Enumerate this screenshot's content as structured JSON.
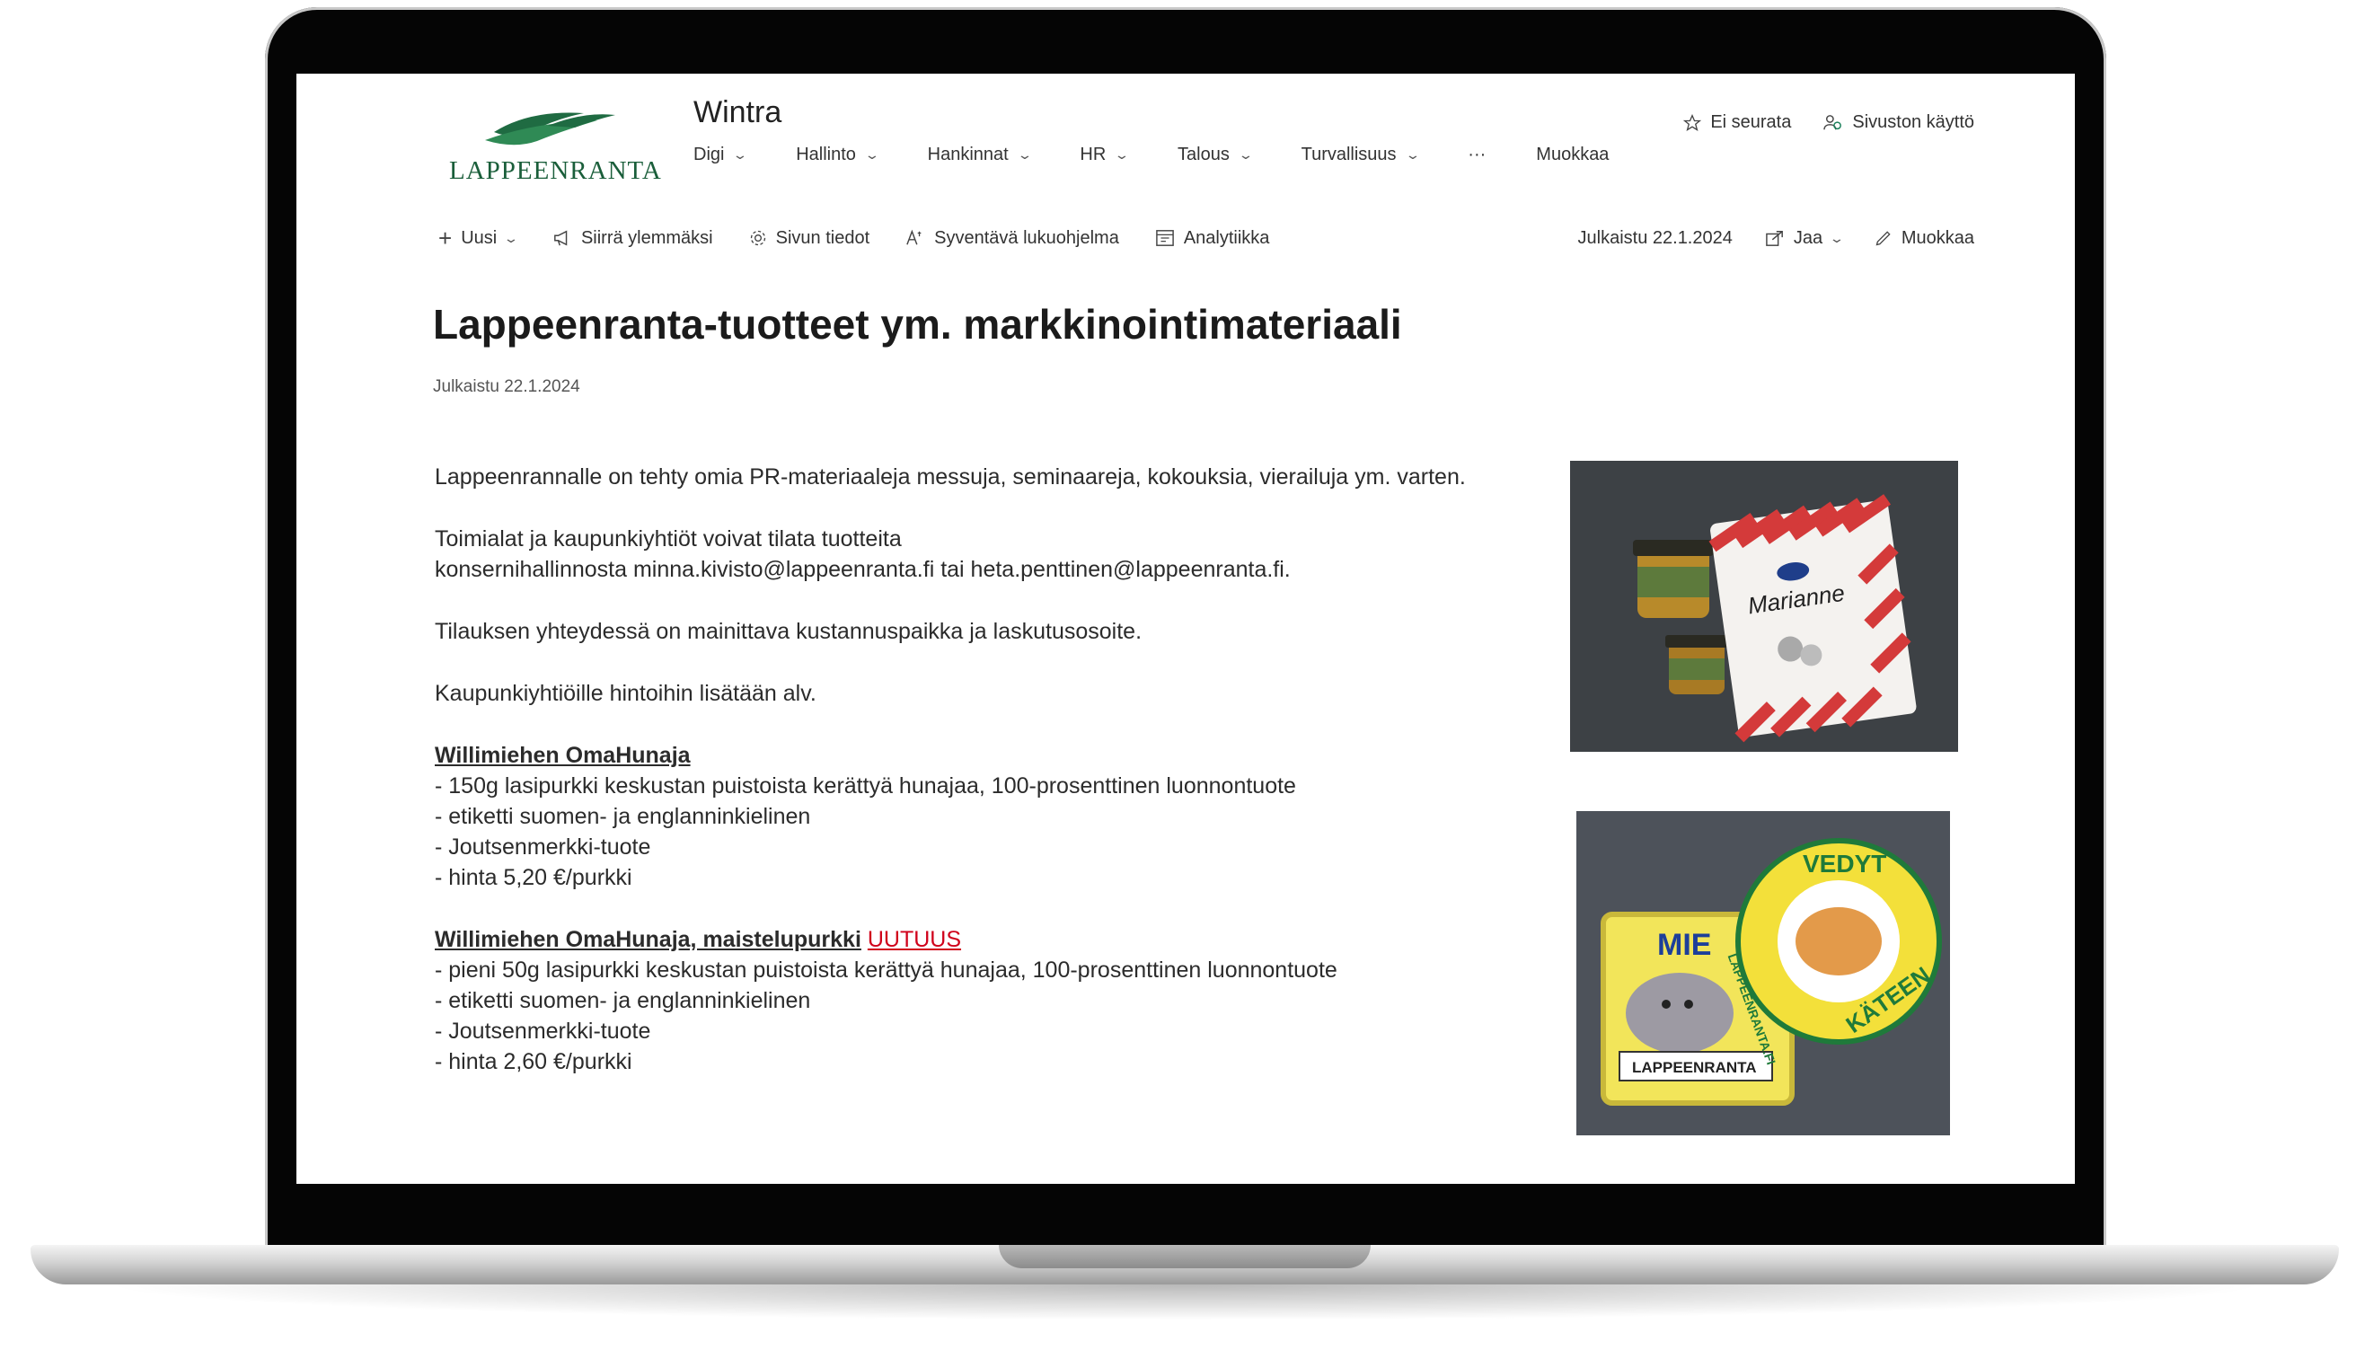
{
  "logo": {
    "text": "LAPPEENRANTA"
  },
  "site": {
    "title": "Wintra"
  },
  "nav": {
    "items": [
      {
        "label": "Digi"
      },
      {
        "label": "Hallinto"
      },
      {
        "label": "Hankinnat"
      },
      {
        "label": "HR"
      },
      {
        "label": "Talous"
      },
      {
        "label": "Turvallisuus"
      }
    ],
    "more": "···",
    "edit": "Muokkaa"
  },
  "header_actions": {
    "follow": "Ei seurata",
    "site_access": "Sivuston käyttö"
  },
  "commandbar": {
    "new": "Uusi",
    "promote": "Siirrä ylemmäksi",
    "page_details": "Sivun tiedot",
    "immersive_reader": "Syventävä lukuohjelma",
    "analytics": "Analytiikka",
    "published": "Julkaistu 22.1.2024",
    "share": "Jaa",
    "edit": "Muokkaa"
  },
  "article": {
    "title": "Lappeenranta-tuotteet ym. markkinointimateriaali",
    "published": "Julkaistu 22.1.2024",
    "p1": "Lappeenrannalle on tehty omia PR-materiaaleja messuja, seminaareja, kokouksia, vierailuja ym. varten.",
    "p2_line1": "Toimialat ja kaupunkiyhtiöt voivat tilata tuotteita",
    "p2_line2": "konsernihallinnosta minna.kivisto@lappeenranta.fi tai heta.penttinen@lappeenranta.fi.",
    "p3": "Tilauksen yhteydessä on mainittava kustannuspaikka ja laskutusosoite.",
    "p4": "Kaupunkiyhtiöille hintoihin lisätään alv.",
    "product1": {
      "title": "Willimiehen OmaHunaja",
      "bullets": [
        "- 150g lasipurkki keskustan puistoista kerättyä hunajaa, 100-prosenttinen luonnontuote",
        "- etiketti suomen- ja englanninkielinen",
        "- Joutsenmerkki-tuote",
        "- hinta 5,20 €/purkki"
      ]
    },
    "product2": {
      "title": "Willimiehen OmaHunaja, maistelupurkki",
      "badge": "UUTUUS",
      "bullets": [
        "- pieni 50g lasipurkki keskustan puistoista kerättyä hunajaa, 100-prosenttinen luonnontuote",
        "- etiketti suomen- ja englanninkielinen",
        "- Joutsenmerkki-tuote",
        "- hinta 2,60 €/purkki"
      ]
    }
  },
  "images": {
    "photo1_candy_label": "Marianne",
    "photo2_patch1_text": "MIE",
    "photo2_patch1_banner": "LAPPEENRANTA",
    "photo2_patch2_top": "VEDYT",
    "photo2_patch2_bottom": "KÄTEEN",
    "photo2_patch2_side": "LAPPEENRANTA.FI"
  }
}
